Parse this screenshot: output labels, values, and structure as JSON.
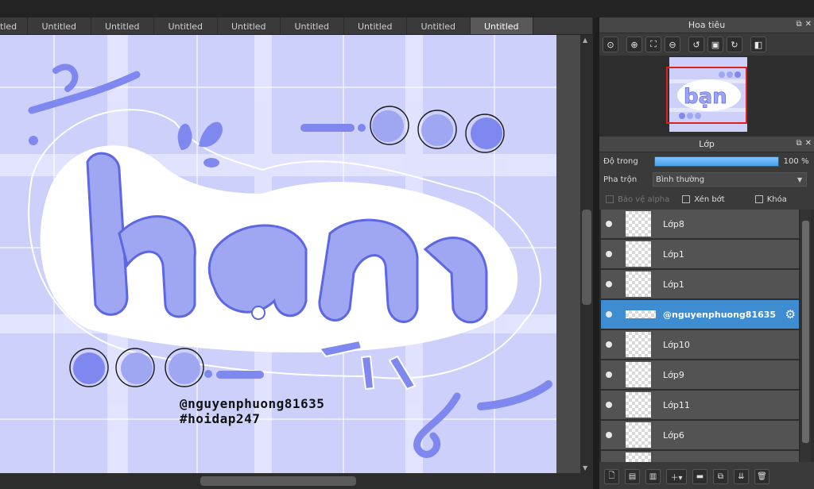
{
  "tabs": [
    {
      "label": "tled",
      "active": false
    },
    {
      "label": "Untitled",
      "active": false
    },
    {
      "label": "Untitled",
      "active": false
    },
    {
      "label": "Untitled",
      "active": false
    },
    {
      "label": "Untitled",
      "active": false
    },
    {
      "label": "Untitled",
      "active": false
    },
    {
      "label": "Untitled",
      "active": false
    },
    {
      "label": "Untitled",
      "active": false
    },
    {
      "label": "Untitled",
      "active": true
    }
  ],
  "canvas": {
    "big_text": "bạn",
    "watermark_user": "@nguyenphuong81635",
    "watermark_tag": "#hoidap247",
    "colors": {
      "bg": "#ccd0fa",
      "grid_light": "#e6e8ff",
      "letter": "#9fa6f2",
      "letter_dark": "#5d67e4",
      "outline": "#ffffff"
    }
  },
  "navigator": {
    "title": "Hoa tiêu",
    "tools": [
      "zoom-actual-icon",
      "zoom-in-icon",
      "fit-icon",
      "zoom-out-icon",
      "rotate-left-icon",
      "fit-window-icon",
      "rotate-right-icon",
      "flip-icon"
    ]
  },
  "layers_panel": {
    "title": "Lớp",
    "opacity_label": "Độ trong",
    "opacity_value": "100 %",
    "opacity_fraction": 1.0,
    "blend_label": "Pha trộn",
    "blend_value": "Bình thường",
    "protect_alpha": "Bảo vệ alpha",
    "clipping": "Xén bớt",
    "lock": "Khóa",
    "layers": [
      {
        "name": "Lớp8",
        "selected": false
      },
      {
        "name": "Lớp1",
        "selected": false
      },
      {
        "name": "Lớp1",
        "selected": false
      },
      {
        "name": "@nguyenphuong81635",
        "selected": true
      },
      {
        "name": "Lớp10",
        "selected": false
      },
      {
        "name": "Lớp9",
        "selected": false
      },
      {
        "name": "Lớp11",
        "selected": false
      },
      {
        "name": "Lớp6",
        "selected": false
      }
    ]
  },
  "accent": "#3d8dd0"
}
